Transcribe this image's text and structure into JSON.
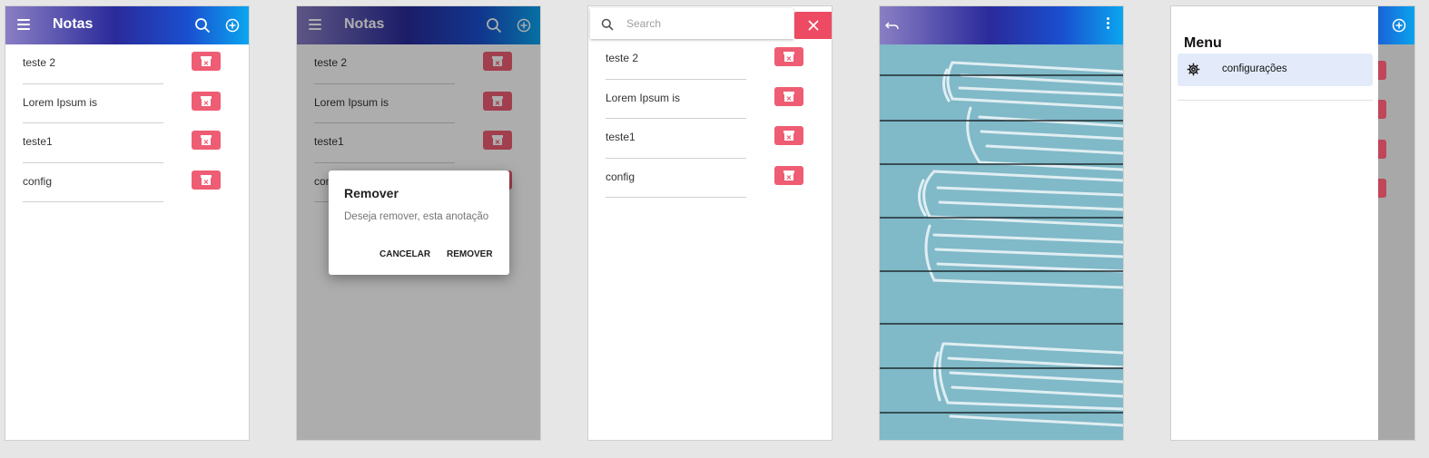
{
  "app": {
    "title": "Notas"
  },
  "notes": [
    "teste 2",
    "Lorem Ipsum is",
    "teste1",
    "config"
  ],
  "icons": {
    "menu": "menu-icon",
    "search": "search-icon",
    "add": "add-circle-icon",
    "delete": "archive-delete-icon",
    "close": "close-icon",
    "back": "back-arrow-icon",
    "more": "more-vert-icon",
    "settings": "gear-icon"
  },
  "dialog": {
    "title": "Remover",
    "message": "Deseja remover, esta anotação",
    "cancel": "CANCELAR",
    "confirm": "REMOVER"
  },
  "search": {
    "placeholder": "Search",
    "value": ""
  },
  "drawer": {
    "title": "Menu",
    "items": [
      {
        "label": "configurações",
        "icon": "gear-icon"
      }
    ]
  },
  "colors": {
    "toolbar_gradient": [
      "#8a7fc4",
      "#2a2a9a",
      "#1a4fcf",
      "#0aa6f0"
    ],
    "delete_button": "#ee5d73",
    "close_button": "#ec4b63",
    "note_background": "#80b9c8",
    "drawer_selected": "#e3ebfa"
  }
}
